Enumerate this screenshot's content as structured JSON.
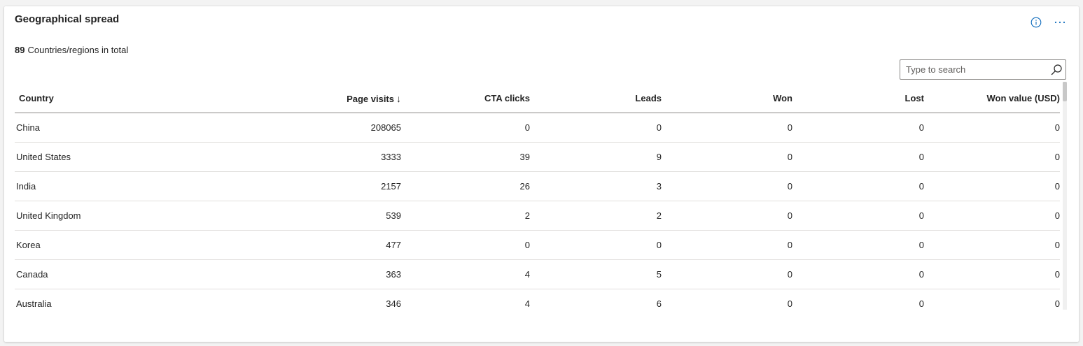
{
  "widget": {
    "title": "Geographical spread",
    "summary_count": "89",
    "summary_text": "Countries/regions in total"
  },
  "icons": {
    "info": "info-icon",
    "more": "more-options-icon",
    "search": "search-icon",
    "sort": "sort-descending-arrow"
  },
  "search": {
    "placeholder": "Type to search",
    "value": ""
  },
  "table": {
    "columns": [
      "Country",
      "Page visits",
      "CTA clicks",
      "Leads",
      "Won",
      "Lost",
      "Won value (USD)"
    ],
    "sort_arrow": "↓",
    "rows": [
      [
        "China",
        "208065",
        "0",
        "0",
        "0",
        "0",
        "0"
      ],
      [
        "United States",
        "3333",
        "39",
        "9",
        "0",
        "0",
        "0"
      ],
      [
        "India",
        "2157",
        "26",
        "3",
        "0",
        "0",
        "0"
      ],
      [
        "United Kingdom",
        "539",
        "2",
        "2",
        "0",
        "0",
        "0"
      ],
      [
        "Korea",
        "477",
        "0",
        "0",
        "0",
        "0",
        "0"
      ],
      [
        "Canada",
        "363",
        "4",
        "5",
        "0",
        "0",
        "0"
      ],
      [
        "Australia",
        "346",
        "4",
        "6",
        "0",
        "0",
        "0"
      ]
    ]
  },
  "colors": {
    "accent": "#0f6cbd",
    "text": "#242424",
    "border": "#e1dfdd"
  }
}
